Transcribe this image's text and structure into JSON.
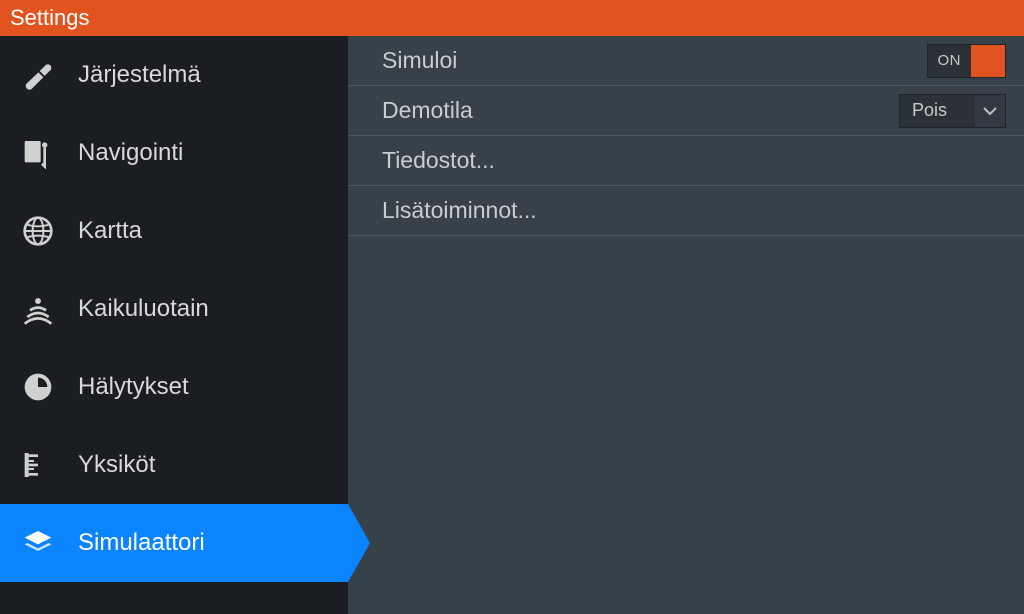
{
  "header": {
    "title": "Settings"
  },
  "sidebar": {
    "items": [
      {
        "label": "Järjestelmä",
        "icon": "wrench-icon",
        "active": false
      },
      {
        "label": "Navigointi",
        "icon": "navigation-icon",
        "active": false
      },
      {
        "label": "Kartta",
        "icon": "globe-icon",
        "active": false
      },
      {
        "label": "Kaikuluotain",
        "icon": "sonar-icon",
        "active": false
      },
      {
        "label": "Hälytykset",
        "icon": "alarm-icon",
        "active": false
      },
      {
        "label": "Yksiköt",
        "icon": "ruler-icon",
        "active": false
      },
      {
        "label": "Simulaattori",
        "icon": "layers-icon",
        "active": true
      }
    ]
  },
  "content": {
    "rows": [
      {
        "label": "Simuloi",
        "toggle": {
          "state": "ON"
        }
      },
      {
        "label": "Demotila",
        "select": {
          "value": "Pois"
        }
      },
      {
        "label": "Tiedostot..."
      },
      {
        "label": "Lisätoiminnot..."
      }
    ]
  }
}
